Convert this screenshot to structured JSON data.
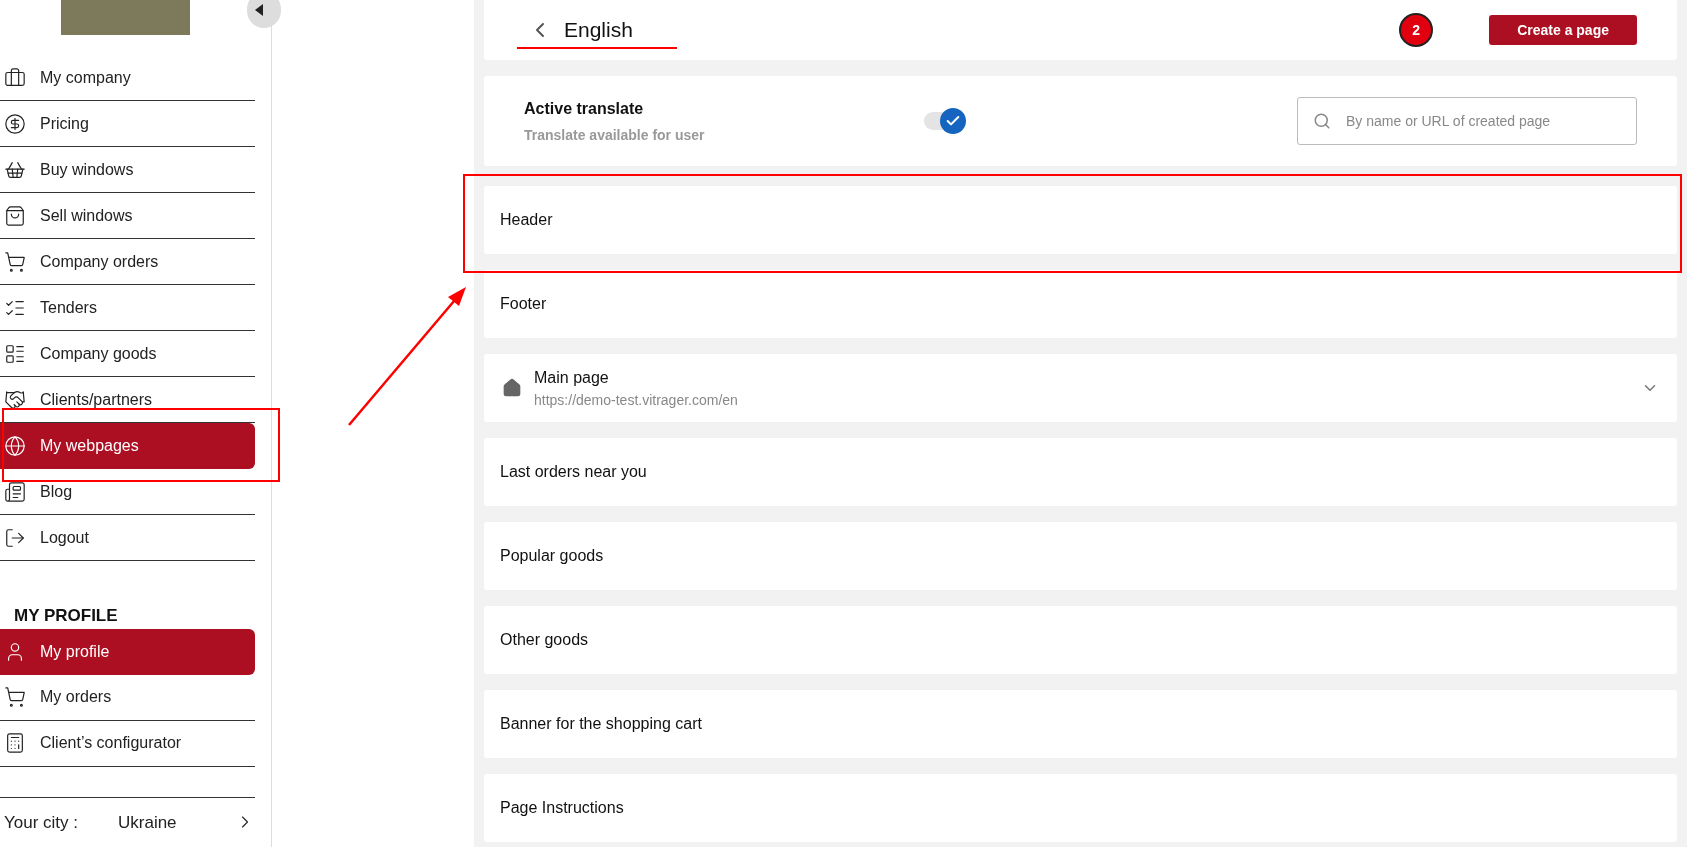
{
  "sidebar": {
    "items": [
      {
        "label": "My company",
        "selected": false
      },
      {
        "label": "Pricing",
        "selected": false
      },
      {
        "label": "Buy windows",
        "selected": false
      },
      {
        "label": "Sell windows",
        "selected": false
      },
      {
        "label": "Company orders",
        "selected": false
      },
      {
        "label": "Tenders",
        "selected": false
      },
      {
        "label": "Company goods",
        "selected": false
      },
      {
        "label": "Clients/partners",
        "selected": false
      },
      {
        "label": "My webpages",
        "selected": true
      },
      {
        "label": "Blog",
        "selected": false
      },
      {
        "label": "Logout",
        "selected": false
      }
    ],
    "profile_heading": "MY PROFILE",
    "profile_items": [
      {
        "label": "My profile",
        "selected": true
      },
      {
        "label": "My orders",
        "selected": false
      },
      {
        "label": "Client’s configurator",
        "selected": false
      }
    ],
    "city_label": "Your city :",
    "city": "Ukraine"
  },
  "header": {
    "title": "English",
    "badge": "2",
    "create_button": "Create a page"
  },
  "translate": {
    "title": "Active translate",
    "subtitle": "Translate available for user",
    "on": true,
    "search_placeholder": "By name or URL of created page"
  },
  "sections": [
    {
      "kind": "plain",
      "title": "Header"
    },
    {
      "kind": "plain",
      "title": "Footer"
    },
    {
      "kind": "page",
      "title": "Main page",
      "url": "https://demo-test.vitrager.com/en"
    },
    {
      "kind": "plain",
      "title": "Last orders near you"
    },
    {
      "kind": "plain",
      "title": "Popular goods"
    },
    {
      "kind": "plain",
      "title": "Other goods"
    },
    {
      "kind": "plain",
      "title": "Banner for the shopping cart"
    },
    {
      "kind": "plain",
      "title": "Page Instructions"
    }
  ]
}
